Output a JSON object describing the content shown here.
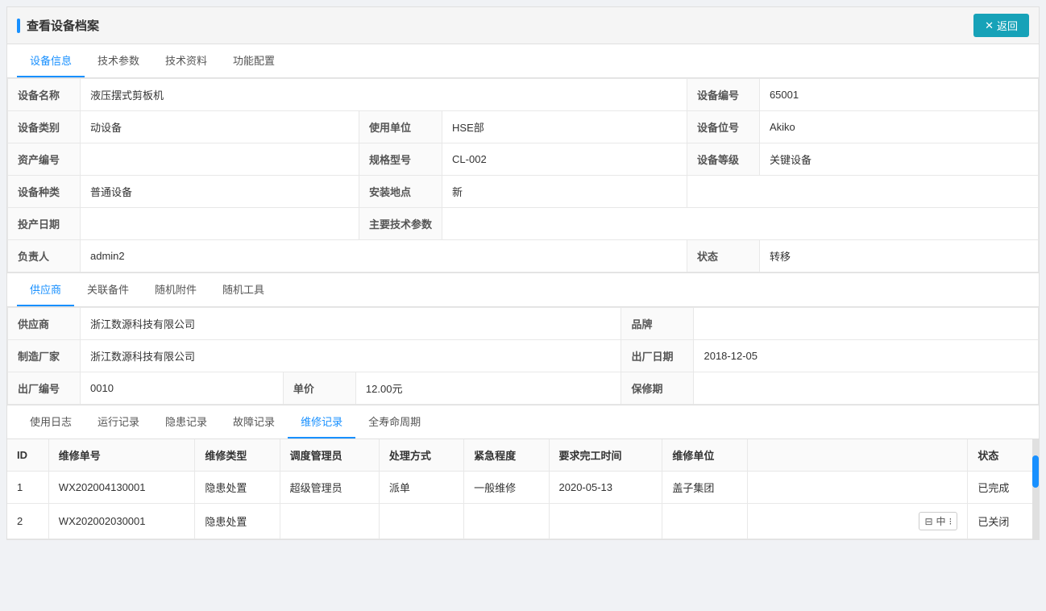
{
  "header": {
    "title": "查看设备档案",
    "return_label": "返回"
  },
  "tabs": {
    "items": [
      {
        "label": "设备信息",
        "active": true
      },
      {
        "label": "技术参数",
        "active": false
      },
      {
        "label": "技术资料",
        "active": false
      },
      {
        "label": "功能配置",
        "active": false
      }
    ]
  },
  "device_info": {
    "fields": [
      {
        "label": "设备名称",
        "value": "液压摆式剪板机",
        "colspan": 1
      },
      {
        "label": "设备编号",
        "value": "65001",
        "colspan": 1
      }
    ],
    "row1_name_label": "设备名称",
    "row1_name_value": "液压摆式剪板机",
    "row1_code_label": "设备编号",
    "row1_code_value": "65001",
    "row2_type_label": "设备类别",
    "row2_type_value": "动设备",
    "row2_unit_label": "使用单位",
    "row2_unit_value": "HSE部",
    "row2_pos_label": "设备位号",
    "row2_pos_value": "Akiko",
    "row3_asset_label": "资产编号",
    "row3_asset_value": "",
    "row3_spec_label": "规格型号",
    "row3_spec_value": "CL-002",
    "row3_grade_label": "设备等级",
    "row3_grade_value": "关键设备",
    "row4_kind_label": "设备种类",
    "row4_kind_value": "普通设备",
    "row4_install_label": "安装地点",
    "row4_install_value": "新",
    "row5_date_label": "投产日期",
    "row5_date_value": "",
    "row5_tech_label": "主要技术参数",
    "row5_tech_value": "",
    "row6_person_label": "负责人",
    "row6_person_value": "admin2",
    "row6_status_label": "状态",
    "row6_status_value": "转移"
  },
  "supplier_tabs": {
    "items": [
      {
        "label": "供应商",
        "active": true
      },
      {
        "label": "关联备件",
        "active": false
      },
      {
        "label": "随机附件",
        "active": false
      },
      {
        "label": "随机工具",
        "active": false
      }
    ]
  },
  "supplier_info": {
    "supplier_label": "供应商",
    "supplier_value": "浙江数源科技有限公司",
    "brand_label": "品牌",
    "brand_value": "",
    "maker_label": "制造厂家",
    "maker_value": "浙江数源科技有限公司",
    "exit_date_label": "出厂日期",
    "exit_date_value": "2018-12-05",
    "serial_label": "出厂编号",
    "serial_value": "0010",
    "unit_price_label": "单价",
    "unit_price_value": "12.00元",
    "warranty_label": "保修期",
    "warranty_value": ""
  },
  "bottom_tabs": {
    "items": [
      {
        "label": "使用日志",
        "active": false
      },
      {
        "label": "运行记录",
        "active": false
      },
      {
        "label": "隐患记录",
        "active": false
      },
      {
        "label": "故障记录",
        "active": false
      },
      {
        "label": "维修记录",
        "active": true
      },
      {
        "label": "全寿命周期",
        "active": false
      }
    ]
  },
  "maintenance_table": {
    "columns": [
      "ID",
      "维修单号",
      "维修类型",
      "调度管理员",
      "处理方式",
      "紧急程度",
      "要求完工时间",
      "维修单位",
      "状态"
    ],
    "rows": [
      {
        "id": "1",
        "order_no": "WX202004130001",
        "type": "隐患处置",
        "manager": "超级管理员",
        "method": "派单",
        "urgency": "一般维修",
        "deadline": "2020-05-13",
        "unit": "盖子集团",
        "status": "已完成"
      },
      {
        "id": "2",
        "order_no": "WX202002030001",
        "type": "隐患处置",
        "manager": "",
        "method": "",
        "urgency": "",
        "deadline": "",
        "unit": "",
        "status": "已关闭"
      }
    ]
  },
  "lang_switcher": {
    "label": "中",
    "icon": "⊟"
  }
}
